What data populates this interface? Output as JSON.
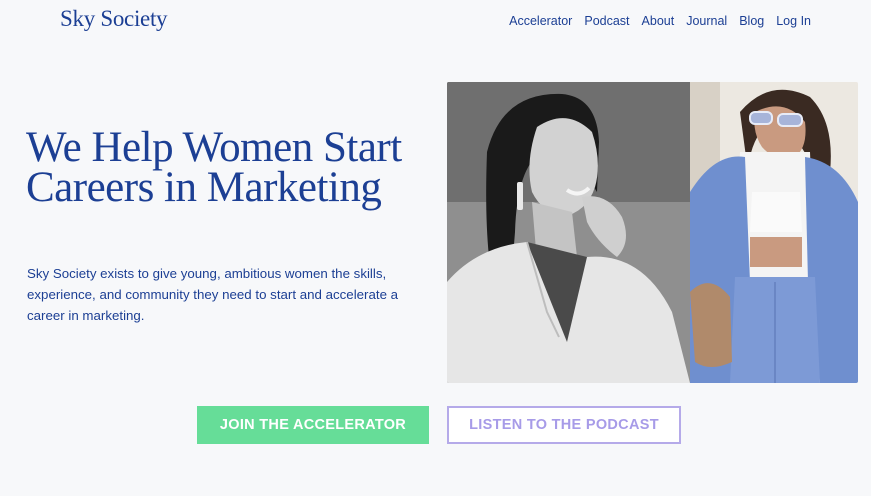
{
  "header": {
    "logo_text": "Sky Society",
    "nav": [
      {
        "label": "Accelerator"
      },
      {
        "label": "Podcast"
      },
      {
        "label": "About"
      },
      {
        "label": "Journal"
      },
      {
        "label": "Blog"
      },
      {
        "label": "Log In"
      }
    ]
  },
  "hero": {
    "headline": "We Help Women Start Careers in Marketing",
    "description": "Sky Society exists to give young, ambitious women the skills, experience, and community they need to start and accelerate a career in marketing.",
    "images": [
      {
        "name": "black-and-white-portrait-woman-smiling"
      },
      {
        "name": "woman-blue-suit-sunglasses"
      }
    ]
  },
  "cta": {
    "primary_label": "JOIN THE ACCELERATOR",
    "secondary_label": "LISTEN TO THE PODCAST"
  },
  "colors": {
    "brand_blue": "#1c3f94",
    "cta_green": "#66dd98",
    "cta_lavender": "#a79be8",
    "background": "#f7f8fa"
  }
}
